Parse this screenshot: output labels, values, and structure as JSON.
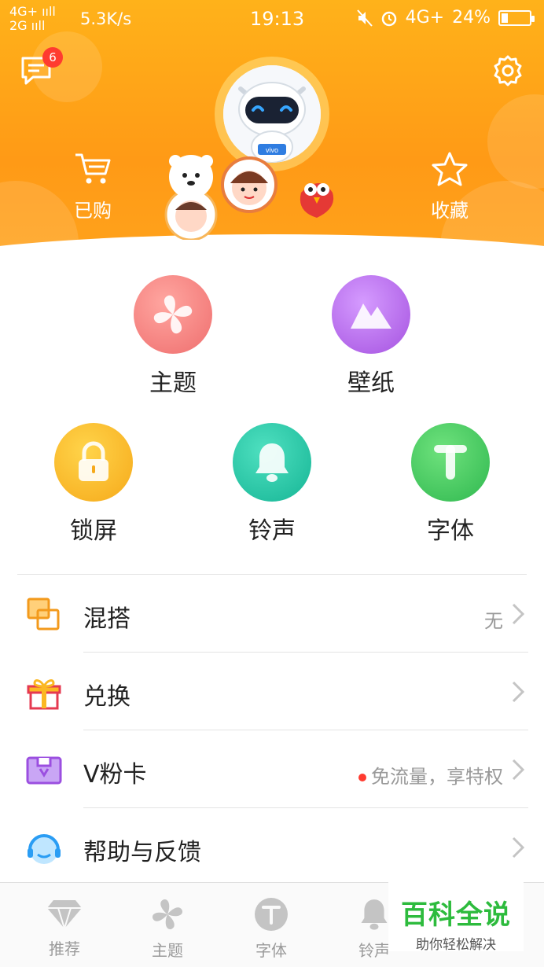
{
  "status_bar": {
    "network_line1": "4G+ ııll",
    "network_line2": "2G ııll",
    "speed": "5.3K/s",
    "time": "19:13",
    "right_network": "4G+",
    "battery_percent_text": "24%",
    "battery_level": 0.24
  },
  "header": {
    "message_badge_count": "6",
    "purchased_label": "已购",
    "favorites_label": "收藏"
  },
  "tiles": {
    "theme": "主题",
    "wallpaper": "壁纸",
    "lockscreen": "锁屏",
    "ringtone": "铃声",
    "font": "字体"
  },
  "list": [
    {
      "label": "混搭",
      "value": "无"
    },
    {
      "label": "兑换",
      "value": ""
    },
    {
      "label": "V粉卡",
      "value": "免流量，享特权"
    },
    {
      "label": "帮助与反馈",
      "value": ""
    }
  ],
  "tabbar": {
    "recommend": "推荐",
    "theme": "主题",
    "font": "字体",
    "ringtone": "铃声"
  },
  "watermark": {
    "title": "百科全说",
    "subtitle": "助你轻松解决"
  },
  "colors": {
    "header_orange": "#ffa31c",
    "theme_pink": "#f37b7b",
    "wallpaper_purple": "#b15fe6",
    "lock_yellow": "#fbb823",
    "ring_teal": "#1fbfa5",
    "font_green": "#3bc45a",
    "badge_red": "#ff3b30"
  }
}
